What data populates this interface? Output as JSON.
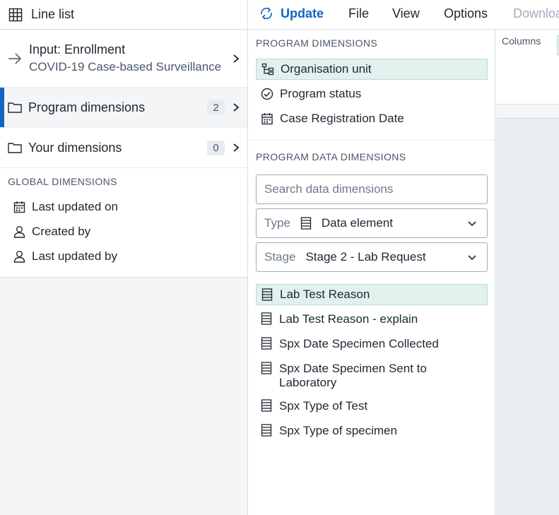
{
  "app": {
    "title": "Line list"
  },
  "sidebar": {
    "input": {
      "label": "Input: Enrollment",
      "program": "COVID-19 Case-based Surveillance"
    },
    "program_dimensions": {
      "label": "Program dimensions",
      "count": "2"
    },
    "your_dimensions": {
      "label": "Your dimensions",
      "count": "0"
    },
    "global": {
      "heading": "GLOBAL DIMENSIONS",
      "items": [
        {
          "label": "Last updated on",
          "icon": "calendar-icon"
        },
        {
          "label": "Created by",
          "icon": "user-icon"
        },
        {
          "label": "Last updated by",
          "icon": "user-icon"
        }
      ]
    }
  },
  "menubar": {
    "update": "Update",
    "file": "File",
    "view": "View",
    "options": "Options",
    "download": "Downloa"
  },
  "panel": {
    "program_heading": "PROGRAM DIMENSIONS",
    "program_items": [
      {
        "label": "Organisation unit",
        "icon": "org-unit-icon"
      },
      {
        "label": "Program status",
        "icon": "check-circle-icon"
      },
      {
        "label": "Case Registration Date",
        "icon": "calendar-icon"
      }
    ],
    "data_heading": "PROGRAM DATA DIMENSIONS",
    "search_placeholder": "Search data dimensions",
    "type": {
      "label": "Type",
      "value": "Data element"
    },
    "stage": {
      "label": "Stage",
      "value": "Stage 2 - Lab Request"
    },
    "data_items": [
      {
        "label": "Lab Test Reason"
      },
      {
        "label": "Lab Test Reason - explain"
      },
      {
        "label": "Spx Date Specimen Collected"
      },
      {
        "label": "Spx Date Specimen Sent to Laboratory"
      },
      {
        "label": "Spx Type of Test"
      },
      {
        "label": "Spx Type of specimen"
      }
    ]
  },
  "layout": {
    "columns_label": "Columns"
  },
  "colors": {
    "accent": "#1565c0",
    "selected_bg": "#e0f1ee",
    "sidebar_bg": "#f3f5f7"
  }
}
